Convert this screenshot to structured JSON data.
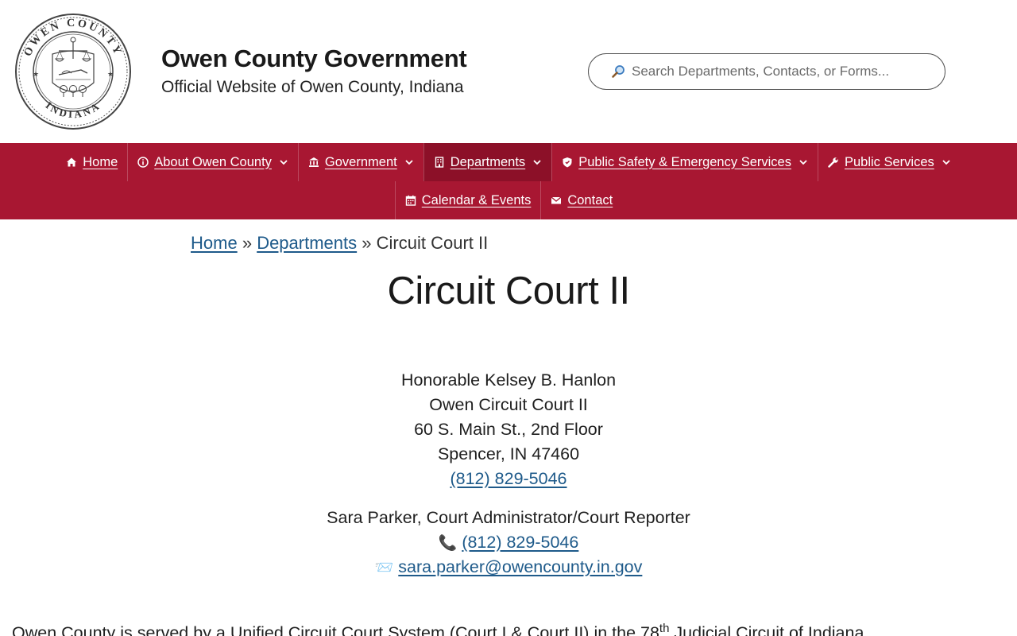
{
  "header": {
    "seal_top_text": "OWEN COUNTY",
    "seal_bottom_text": "INDIANA",
    "title": "Owen County Government",
    "tagline": "Official Website of Owen County, Indiana",
    "search_placeholder": "Search Departments, Contacts, or Forms..."
  },
  "nav": {
    "items": [
      {
        "label": "Home",
        "icon": "home-icon"
      },
      {
        "label": "About Owen County",
        "icon": "info-icon"
      },
      {
        "label": "Government",
        "icon": "bank-icon"
      },
      {
        "label": "Departments",
        "icon": "building-icon"
      },
      {
        "label": "Public Safety & Emergency Services",
        "icon": "shield-icon"
      },
      {
        "label": "Public Services",
        "icon": "wrench-icon"
      },
      {
        "label": "Calendar & Events",
        "icon": "calendar-icon"
      },
      {
        "label": "Contact",
        "icon": "mail-icon"
      }
    ]
  },
  "breadcrumb": {
    "home": "Home",
    "sep1": "»",
    "departments": "Departments",
    "sep2": "»",
    "current": "Circuit Court II"
  },
  "page": {
    "title": "Circuit Court II"
  },
  "judge": {
    "name": "Honorable Kelsey B. Hanlon",
    "court": "Owen Circuit Court II",
    "address": "60 S. Main St., 2nd Floor",
    "city": "Spencer, IN 47460",
    "phone": "(812) 829-5046"
  },
  "administrator": {
    "name": "Sara Parker, Court Administrator/Court Reporter",
    "phone_icon": "📞",
    "phone": "(812) 829-5046",
    "email_icon": "📨",
    "email": "sara.parker@owencounty.in.gov"
  },
  "intro": {
    "text_before": "Owen County is served by a Unified Circuit Court System (Court I & Court II) in the 78",
    "superscript": "th",
    "text_after": " Judicial Circuit of Indiana."
  },
  "colors": {
    "nav_bg": "#a81732",
    "nav_active": "#8c1028",
    "link": "#1e5a8a"
  }
}
